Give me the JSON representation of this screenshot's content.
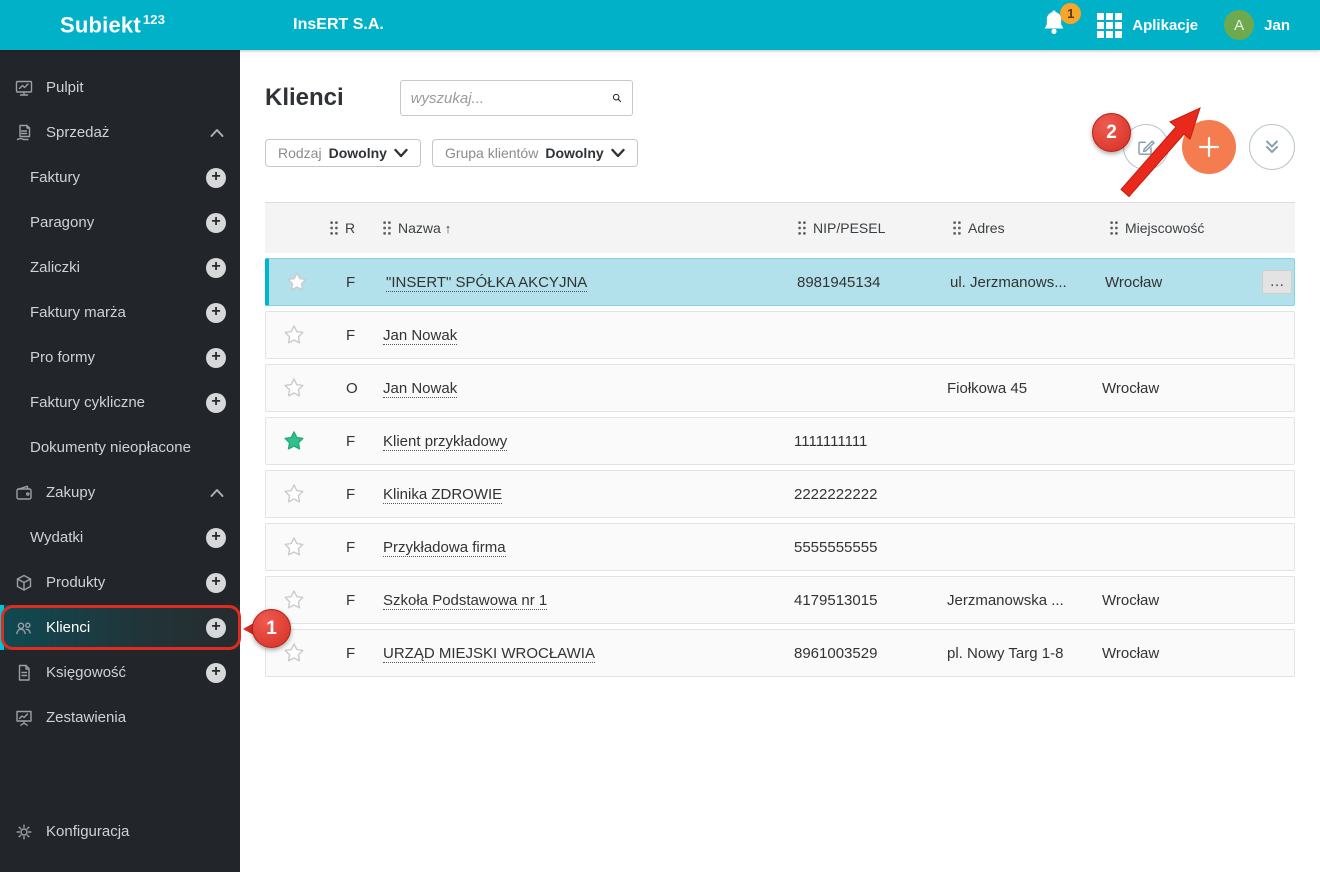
{
  "topbar": {
    "brand": "Subiekt",
    "brand_sup": "123",
    "company": "InsERT S.A.",
    "notification_count": "1",
    "apps_label": "Aplikacje",
    "avatar_initial": "A",
    "user_name": "Jan"
  },
  "sidebar": {
    "items": [
      {
        "label": "Pulpit",
        "icon": "desktop",
        "level": 0
      },
      {
        "label": "Sprzedaż",
        "icon": "sales",
        "level": 0,
        "chevron": true
      },
      {
        "label": "Faktury",
        "level": 1,
        "plus": true
      },
      {
        "label": "Paragony",
        "level": 1,
        "plus": true
      },
      {
        "label": "Zaliczki",
        "level": 1,
        "plus": true
      },
      {
        "label": "Faktury marża",
        "level": 1,
        "plus": true
      },
      {
        "label": "Pro formy",
        "level": 1,
        "plus": true
      },
      {
        "label": "Faktury cykliczne",
        "level": 1,
        "plus": true
      },
      {
        "label": "Dokumenty nieopłacone",
        "level": 1
      },
      {
        "label": "Zakupy",
        "icon": "wallet",
        "level": 0,
        "chevron": true
      },
      {
        "label": "Wydatki",
        "level": 1,
        "plus": true
      },
      {
        "label": "Produkty",
        "icon": "box",
        "level": 0,
        "plus": true
      },
      {
        "label": "Klienci",
        "icon": "people",
        "level": 0,
        "plus": true,
        "selected": true
      },
      {
        "label": "Księgowość",
        "icon": "doc",
        "level": 0,
        "plus": true
      },
      {
        "label": "Zestawienia",
        "icon": "presentation",
        "level": 0
      }
    ],
    "config_item": {
      "label": "Konfiguracja",
      "icon": "gear"
    }
  },
  "header": {
    "title": "Klienci",
    "search_placeholder": "wyszukaj...",
    "filters": [
      {
        "label": "Rodzaj",
        "value": "Dowolny"
      },
      {
        "label": "Grupa klientów",
        "value": "Dowolny"
      }
    ]
  },
  "table": {
    "columns": [
      "R",
      "Nazwa",
      "NIP/PESEL",
      "Adres",
      "Miejscowość"
    ],
    "sort_column": "Nazwa",
    "sort_indicator": "↑",
    "rows": [
      {
        "favorite": false,
        "type": "F",
        "name": "\"INSERT\" SPÓŁKA AKCYJNA",
        "nip": "8981945134",
        "address": "ul. Jerzmanows...",
        "city": "Wrocław",
        "selected": true,
        "actions": "…"
      },
      {
        "favorite": false,
        "type": "F",
        "name": "Jan Nowak",
        "nip": "",
        "address": "",
        "city": ""
      },
      {
        "favorite": false,
        "type": "O",
        "name": "Jan Nowak",
        "nip": "",
        "address": "Fiołkowa 45",
        "city": "Wrocław"
      },
      {
        "favorite": true,
        "type": "F",
        "name": "Klient przykładowy",
        "nip": "1111111111",
        "address": "",
        "city": ""
      },
      {
        "favorite": false,
        "type": "F",
        "name": "Klinika ZDROWIE",
        "nip": "2222222222",
        "address": "",
        "city": ""
      },
      {
        "favorite": false,
        "type": "F",
        "name": "Przykładowa firma",
        "nip": "5555555555",
        "address": "",
        "city": ""
      },
      {
        "favorite": false,
        "type": "F",
        "name": "Szkoła Podstawowa nr 1",
        "nip": "4179513015",
        "address": "Jerzmanowska ...",
        "city": "Wrocław"
      },
      {
        "favorite": false,
        "type": "F",
        "name": "URZĄD MIEJSKI WROCŁAWIA",
        "nip": "8961003529",
        "address": "pl. Nowy Targ 1-8",
        "city": "Wrocław"
      }
    ]
  },
  "annotations": {
    "step1": "1",
    "step2": "2"
  },
  "colors": {
    "accent": "#00b1c8",
    "primary_button": "#f47c4f",
    "annotation_red": "#e02b20",
    "selected_row": "#b2e1ec",
    "favorite_star": "#2fc08e",
    "notification_badge": "#f5a62b",
    "avatar_green": "#6fa94e"
  }
}
